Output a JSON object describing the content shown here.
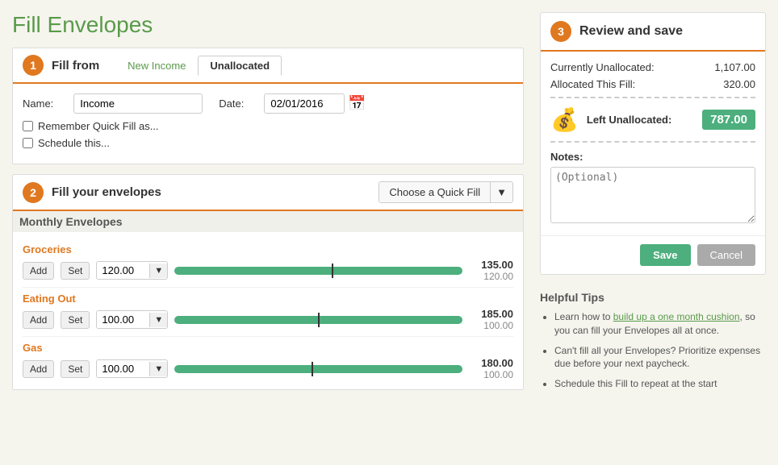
{
  "page": {
    "title": "Fill Envelopes"
  },
  "section1": {
    "number": "1",
    "title": "Fill from",
    "tabs": [
      {
        "label": "New Income",
        "active": false
      },
      {
        "label": "Unallocated",
        "active": true
      }
    ],
    "name_label": "Name:",
    "name_value": "Income",
    "date_label": "Date:",
    "date_value": "02/01/2016",
    "checkbox1_label": "Remember Quick Fill as...",
    "checkbox2_label": "Schedule this..."
  },
  "section2": {
    "number": "2",
    "title": "Fill your envelopes",
    "quick_fill_label": "Choose a Quick Fill",
    "group_title": "Monthly Envelopes",
    "envelopes": [
      {
        "name": "Groceries",
        "amount": "120.00",
        "current": "135.00",
        "budget": "120.00",
        "slider_pct": 60
      },
      {
        "name": "Eating Out",
        "amount": "100.00",
        "current": "185.00",
        "budget": "100.00",
        "slider_pct": 55
      },
      {
        "name": "Gas",
        "amount": "100.00",
        "current": "180.00",
        "budget": "100.00",
        "slider_pct": 50
      }
    ],
    "add_label": "Add",
    "set_label": "Set"
  },
  "section3": {
    "number": "3",
    "title": "Review and save",
    "currently_unallocated_label": "Currently Unallocated:",
    "currently_unallocated_value": "1,107.00",
    "allocated_this_fill_label": "Allocated This Fill:",
    "allocated_this_fill_value": "320.00",
    "left_unallocated_label": "Left Unallocated:",
    "left_unallocated_value": "787.00",
    "notes_label": "Notes:",
    "notes_placeholder": "(Optional)",
    "save_label": "Save",
    "cancel_label": "Cancel"
  },
  "helpful_tips": {
    "title": "Helpful Tips",
    "tips": [
      {
        "text": "Learn how to build up a one month cushion, so you can fill your Envelopes all at once.",
        "link_text": "build up a one month cushion"
      },
      {
        "text": "Can't fill all your Envelopes? Prioritize expenses due before your next paycheck."
      },
      {
        "text": "Schedule this Fill to repeat at the start"
      }
    ]
  }
}
